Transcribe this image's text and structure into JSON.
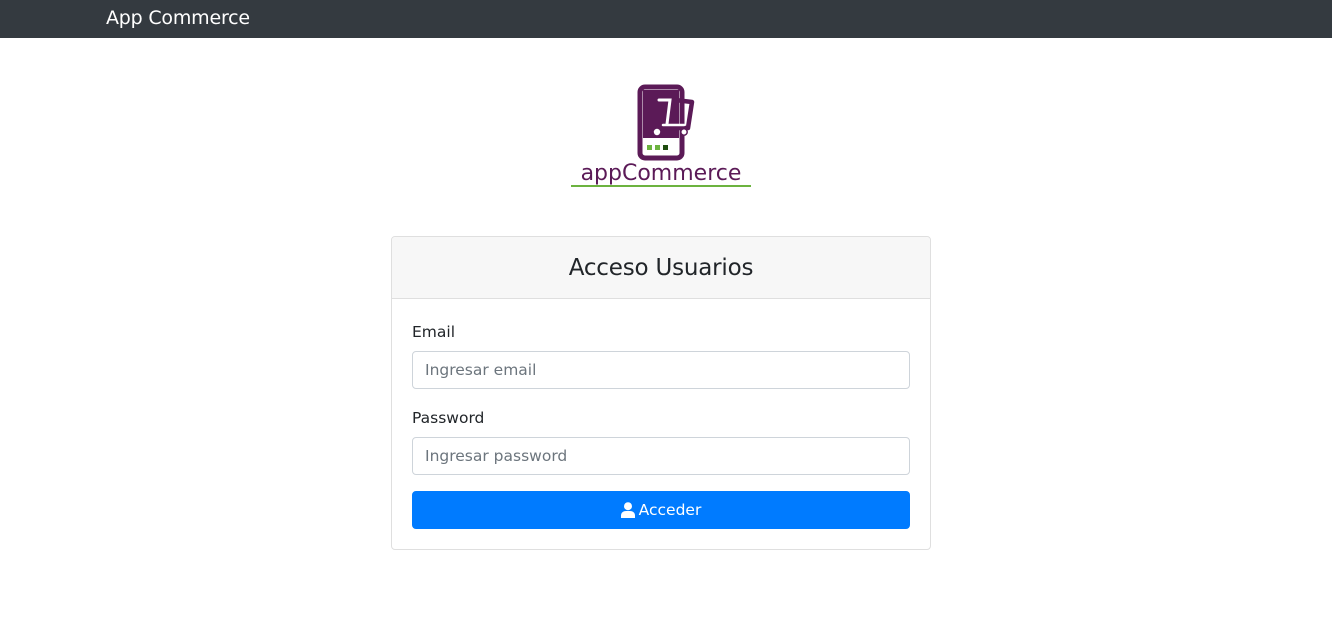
{
  "navbar": {
    "brand": "App Commerce",
    "background": "#343a40"
  },
  "logo": {
    "wordmark": "appCommerce",
    "primary_color": "#5b1a57",
    "accent_color": "#6cb33f"
  },
  "login_card": {
    "title": "Acceso Usuarios",
    "email": {
      "label": "Email",
      "value": "",
      "placeholder": "Ingresar email"
    },
    "password": {
      "label": "Password",
      "value": "",
      "placeholder": "Ingresar password"
    },
    "submit": {
      "label": "Acceder",
      "icon": "user-icon",
      "color": "#007bff"
    }
  }
}
